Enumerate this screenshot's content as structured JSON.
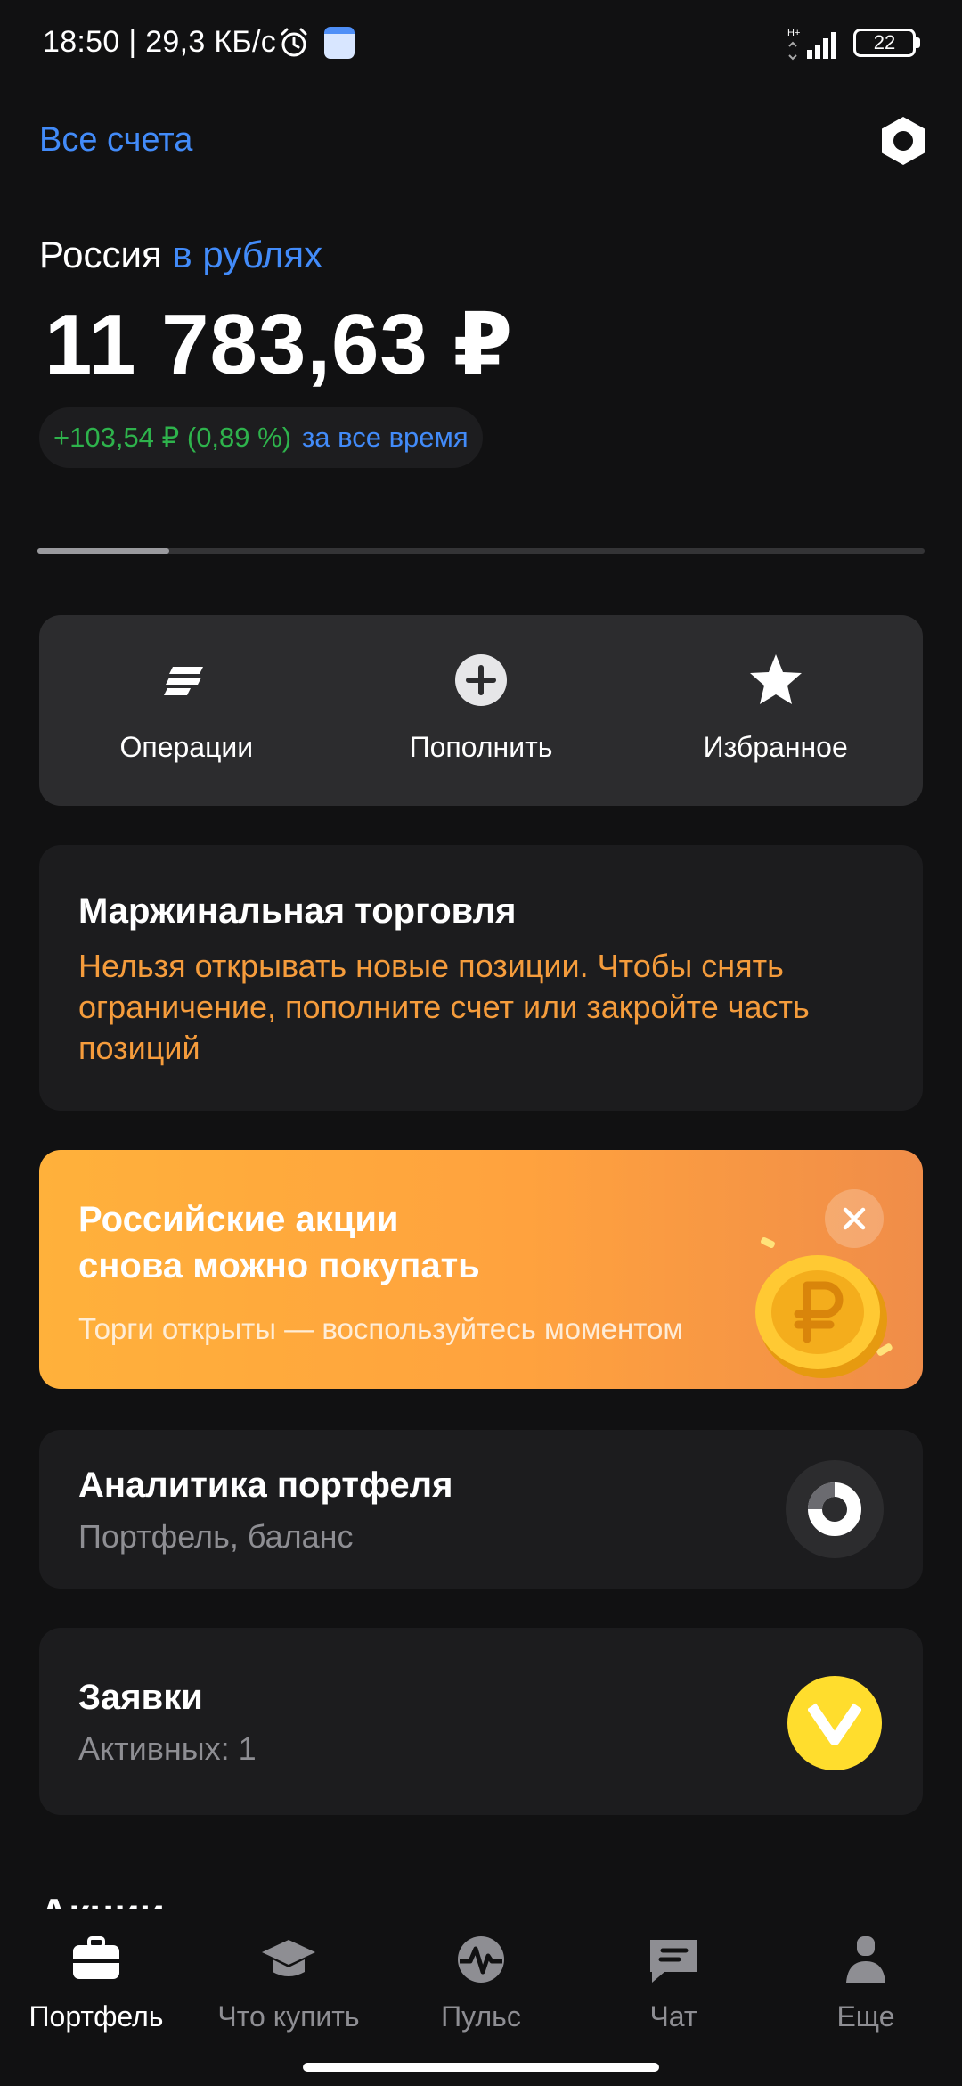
{
  "status_bar": {
    "text": "18:50 | 29,3 КБ/с",
    "network": "H+",
    "battery": "22",
    "icons": [
      "alarm-icon",
      "calendar-icon",
      "signal-icon",
      "battery-icon"
    ]
  },
  "header": {
    "all_accounts": "Все счета",
    "settings_icon": "gear-hex-icon"
  },
  "account": {
    "region": "Россия",
    "currency": "в рублях",
    "balance": "11 783,63 ₽",
    "gain": "+103,54 ₽ (0,89 %)",
    "gain_period": "за все время",
    "gain_color": "#2eb34c"
  },
  "quick_actions": [
    {
      "label": "Операции",
      "icon": "operations-icon"
    },
    {
      "label": "Пополнить",
      "icon": "plus-circle-icon"
    },
    {
      "label": "Избранное",
      "icon": "star-icon"
    }
  ],
  "margin_notice": {
    "title": "Маржинальная торговля",
    "text": "Нельзя открывать новые позиции. Чтобы снять ограничение, пополните счет или закройте часть позиций",
    "text_color": "#f59c3c"
  },
  "promo": {
    "title_line1": "Российские акции",
    "title_line2": "снова можно покупать",
    "subtitle": "Торги открыты — воспользуйтесь моментом",
    "icon": "ruble-coin-icon"
  },
  "analytics": {
    "title": "Аналитика портфеля",
    "subtitle": "Портфель, баланс",
    "icon": "donut-chart-icon"
  },
  "orders": {
    "title": "Заявки",
    "subtitle": "Активных: 1",
    "icon": "checkmark-badge-icon",
    "accent": "#ffdd2d"
  },
  "next_section": "Акции",
  "bottom_nav": [
    {
      "label": "Портфель",
      "icon": "briefcase-icon",
      "active": true
    },
    {
      "label": "Что купить",
      "icon": "graduation-cap-icon",
      "active": false
    },
    {
      "label": "Пульс",
      "icon": "pulse-icon",
      "active": false
    },
    {
      "label": "Чат",
      "icon": "chat-icon",
      "active": false
    },
    {
      "label": "Еще",
      "icon": "profile-icon",
      "active": false
    }
  ],
  "colors": {
    "accent_blue": "#428bf9",
    "background": "#111112",
    "card": "#1c1c1e"
  }
}
